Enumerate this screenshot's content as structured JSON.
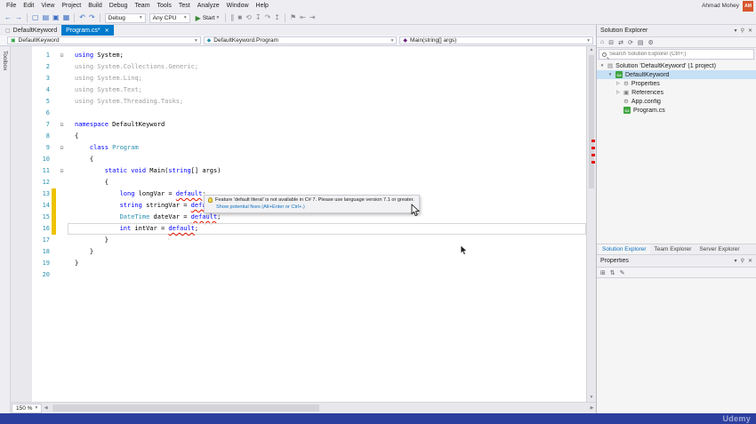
{
  "titlebar": {
    "user": "Ahmad Mohey",
    "avatar": "AM"
  },
  "menubar": [
    "File",
    "Edit",
    "View",
    "Project",
    "Build",
    "Debug",
    "Team",
    "Tools",
    "Test",
    "Analyze",
    "Window",
    "Help"
  ],
  "toolbar": {
    "nav_icons": [
      "navigate-back-icon",
      "navigate-forward-icon"
    ],
    "file_icons": [
      "new-file-icon",
      "open-file-icon",
      "save-icon",
      "save-all-icon"
    ],
    "edit_icons": [
      "undo-icon",
      "redo-icon"
    ],
    "config": "Debug",
    "platform": "Any CPU",
    "start_label": "Start",
    "debug_icons": [
      "pause-icon",
      "stop-icon",
      "restart-icon",
      "step-into-icon",
      "step-over-icon",
      "step-out-icon"
    ],
    "extra_icons": [
      "bookmark-icon",
      "decrease-indent-icon",
      "increase-indent-icon"
    ]
  },
  "tabs": [
    {
      "label": "DefaultKeyword",
      "active": false
    },
    {
      "label": "Program.cs*",
      "active": true,
      "close": "✕"
    }
  ],
  "navbar": {
    "project": "DefaultKeyword",
    "type": "DefaultKeyword.Program",
    "member": "Main(string[] args)"
  },
  "editor": {
    "zoom_level": "150 %",
    "lines": [
      {
        "n": 1,
        "o": 1,
        "tokens": [
          [
            "k",
            "using"
          ],
          [
            "p",
            " System;"
          ]
        ]
      },
      {
        "n": 2,
        "tokens": [
          [
            "g",
            "using System.Collections.Generic;"
          ]
        ]
      },
      {
        "n": 3,
        "tokens": [
          [
            "g",
            "using System.Linq;"
          ]
        ]
      },
      {
        "n": 4,
        "tokens": [
          [
            "g",
            "using System.Text;"
          ]
        ]
      },
      {
        "n": 5,
        "tokens": [
          [
            "g",
            "using System.Threading.Tasks;"
          ]
        ]
      },
      {
        "n": 6,
        "tokens": []
      },
      {
        "n": 7,
        "o": 1,
        "tokens": [
          [
            "k",
            "namespace"
          ],
          [
            "p",
            " DefaultKeyword"
          ]
        ]
      },
      {
        "n": 8,
        "tokens": [
          [
            "p",
            "{"
          ]
        ]
      },
      {
        "n": 9,
        "o": 1,
        "tokens": [
          [
            "p",
            "    "
          ],
          [
            "k",
            "class"
          ],
          [
            "p",
            " "
          ],
          [
            "ty",
            "Program"
          ]
        ]
      },
      {
        "n": 10,
        "tokens": [
          [
            "p",
            "    {"
          ]
        ]
      },
      {
        "n": 11,
        "o": 1,
        "tokens": [
          [
            "p",
            "        "
          ],
          [
            "k",
            "static"
          ],
          [
            "p",
            " "
          ],
          [
            "k",
            "void"
          ],
          [
            "p",
            " Main("
          ],
          [
            "k",
            "string"
          ],
          [
            "p",
            "[] args)"
          ]
        ]
      },
      {
        "n": 12,
        "tokens": [
          [
            "p",
            "        {"
          ]
        ]
      },
      {
        "n": 13,
        "m": 1,
        "tokens": [
          [
            "p",
            "            "
          ],
          [
            "k",
            "long"
          ],
          [
            "p",
            " longVar = "
          ],
          [
            "k err",
            "default"
          ],
          [
            "p",
            ";"
          ]
        ]
      },
      {
        "n": 14,
        "m": 1,
        "tokens": [
          [
            "p",
            "            "
          ],
          [
            "k",
            "string"
          ],
          [
            "p",
            " stringVar = "
          ],
          [
            "k err",
            "default"
          ],
          [
            "p",
            ";"
          ]
        ]
      },
      {
        "n": 15,
        "m": 1,
        "tokens": [
          [
            "p",
            "            "
          ],
          [
            "ty",
            "DateTime"
          ],
          [
            "p",
            " dateVar = "
          ],
          [
            "k err",
            "default"
          ],
          [
            "p",
            ";"
          ]
        ]
      },
      {
        "n": 16,
        "m": 1,
        "c": 1,
        "tokens": [
          [
            "p",
            "            "
          ],
          [
            "k",
            "int"
          ],
          [
            "p",
            " intVar = "
          ],
          [
            "k err",
            "default"
          ],
          [
            "p",
            ";"
          ]
        ]
      },
      {
        "n": 17,
        "tokens": [
          [
            "p",
            "        }"
          ]
        ]
      },
      {
        "n": 18,
        "tokens": [
          [
            "p",
            "    }"
          ]
        ]
      },
      {
        "n": 19,
        "tokens": [
          [
            "p",
            "}"
          ]
        ]
      },
      {
        "n": 20,
        "tokens": []
      }
    ]
  },
  "tooltip": {
    "message": "Feature 'default literal' is not available in C# 7. Please use language version 7.1 or greater.",
    "link": "Show potential fixes (Alt+Enter or Ctrl+.)"
  },
  "solution_explorer": {
    "title": "Solution Explorer",
    "search_placeholder": "Search Solution Explorer (Ctrl+;)",
    "toolbar_icons": [
      "home-icon",
      "collapse-all-icon",
      "sync-with-active-document-icon",
      "refresh-icon",
      "show-all-files-icon",
      "properties-icon"
    ],
    "tree": [
      {
        "label": "Solution 'DefaultKeyword' (1 project)",
        "level": 0,
        "icon": "solution-icon",
        "exp": "open"
      },
      {
        "label": "DefaultKeyword",
        "level": 1,
        "icon": "csharp-project-icon",
        "exp": "open",
        "selected": true
      },
      {
        "label": "Properties",
        "level": 2,
        "icon": "properties-icon",
        "exp": "closed"
      },
      {
        "label": "References",
        "level": 2,
        "icon": "references-icon",
        "exp": "closed"
      },
      {
        "label": "App.config",
        "level": 2,
        "icon": "config-file-icon"
      },
      {
        "label": "Program.cs",
        "level": 2,
        "icon": "csharp-file-icon"
      }
    ],
    "bottom_tabs": [
      {
        "label": "Solution Explorer",
        "active": true
      },
      {
        "label": "Team Explorer",
        "active": false
      },
      {
        "label": "Server Explorer",
        "active": false
      }
    ]
  },
  "properties_panel": {
    "title": "Properties",
    "toolbar_icons": [
      "categorized-icon",
      "alphabetical-icon",
      "property-pages-icon"
    ]
  },
  "toolbox": {
    "label": "Toolbox"
  },
  "statusbar": {
    "watermark": "Udemy"
  },
  "colors": {
    "accent": "#007acc",
    "keyword": "#0000ff",
    "type": "#2b91af",
    "error": "#e51400",
    "change_bar": "#eec200",
    "status_bar": "#2b3f9f"
  }
}
